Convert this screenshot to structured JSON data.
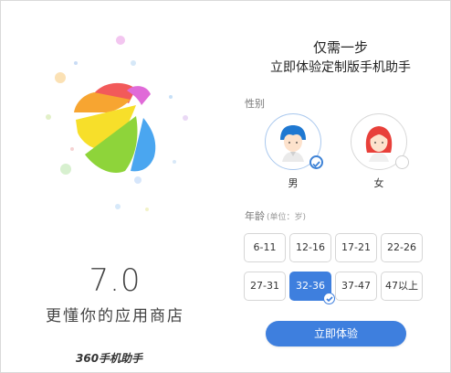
{
  "left": {
    "version": "7.0",
    "tagline": "更懂你的应用商店",
    "brand": "360手机助手"
  },
  "right": {
    "headline": "仅需一步",
    "subline": "立即体验定制版手机助手",
    "gender_label": "性别",
    "genders": [
      {
        "label": "男",
        "selected": true
      },
      {
        "label": "女",
        "selected": false
      }
    ],
    "age_label": "年龄",
    "age_unit": "(单位：岁)",
    "ages": [
      "6-11",
      "12-16",
      "17-21",
      "22-26",
      "27-31",
      "32-36",
      "37-47",
      "47以上"
    ],
    "selected_age": "32-36",
    "start_button": "立即体验"
  },
  "colors": {
    "accent": "#3e7fde",
    "petal_red": "#f25a5a",
    "petal_orange": "#f7a531",
    "petal_yellow": "#f7df2a",
    "petal_green": "#8ed43a",
    "petal_blue": "#4aa6f0",
    "petal_pink": "#e06ad8"
  }
}
